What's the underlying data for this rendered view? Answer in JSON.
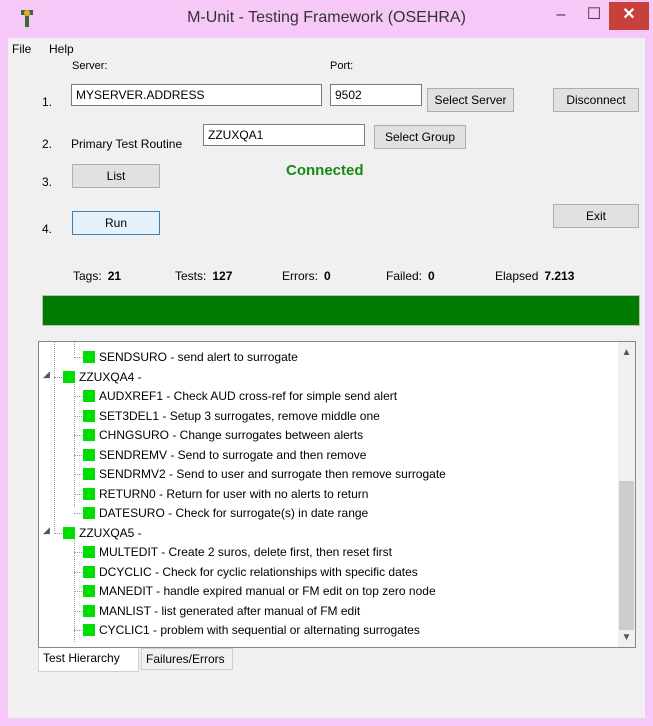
{
  "window": {
    "title": "M-Unit - Testing Framework (OSEHRA)",
    "controls": {
      "minimize": "–",
      "maximize": "☐",
      "close": "✕"
    }
  },
  "menu": {
    "file": "File",
    "help": "Help"
  },
  "steps": {
    "s1": "1.",
    "s2": "2.",
    "s3": "3.",
    "s4": "4."
  },
  "server": {
    "label": "Server:",
    "value": "MYSERVER.ADDRESS",
    "port_label": "Port:",
    "port_value": "9502",
    "select_server": "Select Server",
    "disconnect": "Disconnect"
  },
  "routine": {
    "label": "Primary Test Routine",
    "value": "ZZUXQA1",
    "select_group": "Select Group"
  },
  "actions": {
    "list": "List",
    "run": "Run",
    "exit": "Exit",
    "status": "Connected"
  },
  "stats": {
    "tags_label": "Tags:",
    "tags": "21",
    "tests_label": "Tests:",
    "tests": "127",
    "errors_label": "Errors:",
    "errors": "0",
    "failed_label": "Failed:",
    "failed": "0",
    "elapsed_label": "Elapsed",
    "elapsed": "7.213"
  },
  "progress": {
    "value": 1.0,
    "color": "#007a00"
  },
  "tree": {
    "rows": [
      {
        "text": "SENDSURO - send alert to surrogate",
        "level": 2
      },
      {
        "text": "ZZUXQA4 -",
        "level": 1
      },
      {
        "text": "AUDXREF1 - Check AUD cross-ref for simple send alert",
        "level": 2
      },
      {
        "text": "SET3DEL1 - Setup 3 surrogates, remove middle one",
        "level": 2
      },
      {
        "text": "CHNGSURO - Change surrogates between alerts",
        "level": 2
      },
      {
        "text": "SENDREMV - Send to surrogate and then remove",
        "level": 2
      },
      {
        "text": "SENDRMV2 - Send to user and surrogate then remove surrogate",
        "level": 2
      },
      {
        "text": "RETURN0 - Return for user with no alerts to return",
        "level": 2
      },
      {
        "text": "DATESURO - Check for surrogate(s) in date range",
        "level": 2
      },
      {
        "text": "ZZUXQA5 -",
        "level": 1
      },
      {
        "text": "MULTEDIT - Create 2 suros, delete first, then reset first",
        "level": 2
      },
      {
        "text": "DCYCLIC - Check for cyclic relationships with specific dates",
        "level": 2
      },
      {
        "text": "MANEDIT - handle expired manual or FM edit on top zero node",
        "level": 2
      },
      {
        "text": "MANLIST - list generated after manual of FM edit",
        "level": 2
      },
      {
        "text": "CYCLIC1 - problem with sequential or alternating surrogates",
        "level": 2
      }
    ],
    "status_color": "#00dd00"
  },
  "tabs": {
    "hierarchy": "Test Hierarchy",
    "failures": "Failures/Errors"
  }
}
